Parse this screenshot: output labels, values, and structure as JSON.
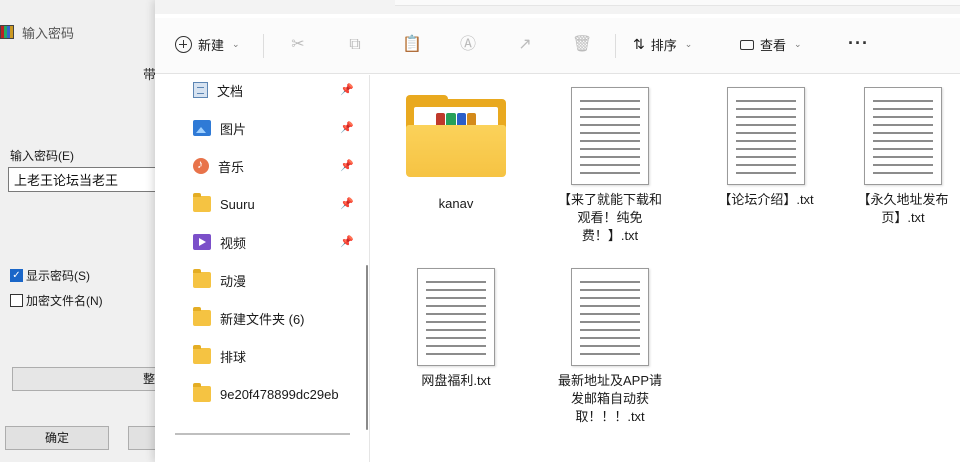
{
  "password_dialog": {
    "title": "输入密码",
    "truncated_top_text": "带",
    "password_label": "输入密码(E)",
    "password_value": "上老王论坛当老王",
    "show_password_label": "显示密码(S)",
    "show_password_checked": true,
    "encrypt_filenames_label": "加密文件名(N)",
    "encrypt_filenames_checked": false,
    "organize_button_truncated": "整",
    "ok_button": "确定"
  },
  "toolbar": {
    "new_label": "新建",
    "sort_label": "排序",
    "view_label": "查看",
    "more_label": "···",
    "icons": [
      "cut-icon",
      "copy-icon",
      "paste-icon",
      "rename-icon",
      "share-icon",
      "delete-icon"
    ]
  },
  "nav": {
    "items": [
      {
        "label": "文档",
        "icon": "documents-icon",
        "pinned": true
      },
      {
        "label": "图片",
        "icon": "pictures-icon",
        "pinned": true
      },
      {
        "label": "音乐",
        "icon": "music-icon",
        "pinned": true
      },
      {
        "label": "Suuru",
        "icon": "folder-icon",
        "pinned": true
      },
      {
        "label": "视频",
        "icon": "videos-icon",
        "pinned": true
      },
      {
        "label": "动漫",
        "icon": "folder-icon",
        "pinned": false
      },
      {
        "label": "新建文件夹 (6)",
        "icon": "folder-icon",
        "pinned": false
      },
      {
        "label": "排球",
        "icon": "folder-icon",
        "pinned": false
      },
      {
        "label": "9e20f478899dc29eb",
        "icon": "folder-icon",
        "pinned": false
      }
    ]
  },
  "files": [
    {
      "name": "kanav",
      "type": "folder"
    },
    {
      "name": "【来了就能下载和观看！纯免费！】.txt",
      "type": "txt"
    },
    {
      "name": "【论坛介绍】.txt",
      "type": "txt"
    },
    {
      "name": "【永久地址发布页】.txt",
      "type": "txt"
    },
    {
      "name": "网盘福利.txt",
      "type": "txt"
    },
    {
      "name": "最新地址及APP请发邮箱自动获取！！！.txt",
      "type": "txt"
    }
  ]
}
